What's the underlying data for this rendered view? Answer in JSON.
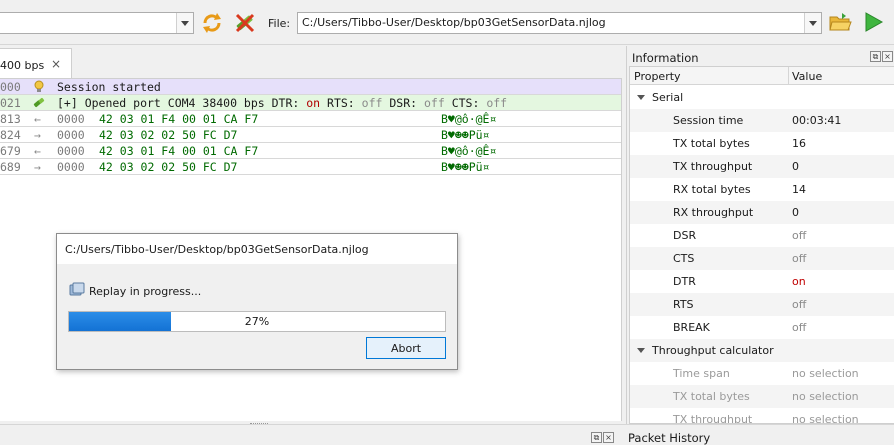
{
  "toolbar": {
    "port_combo_value": "",
    "file_label": "File:",
    "file_path": "C:/Users/Tibbo-User/Desktop/bp03GetSensorData.njlog"
  },
  "tab": {
    "label": "400 bps",
    "close": "×"
  },
  "log": {
    "rows": [
      {
        "ts": "000",
        "icon": "lightbulb-icon",
        "message": "Session started"
      },
      {
        "ts": "021",
        "icon": "plug-icon",
        "message_prefix": "[+] Opened port COM4 38400 bps DTR: ",
        "dtr": "on",
        "rts_label": " RTS: ",
        "rts": "off",
        "dsr_label": " DSR: ",
        "dsr": "off",
        "cts_label": " CTS: ",
        "cts": "off"
      },
      {
        "ts": "813",
        "dir": "←",
        "offset": "0000",
        "hex": "42 03 01 F4 00 01 CA F7",
        "ascii": "B♥@ô·@Ê¤"
      },
      {
        "ts": "824",
        "dir": "→",
        "offset": "0000",
        "hex": "42 03 02 02 50 FC D7",
        "ascii": "B♥☻☻Pü¤"
      },
      {
        "ts": "679",
        "dir": "←",
        "offset": "0000",
        "hex": "42 03 01 F4 00 01 CA F7",
        "ascii": "B♥@ô·@Ê¤"
      },
      {
        "ts": "689",
        "dir": "→",
        "offset": "0000",
        "hex": "42 03 02 02 50 FC D7",
        "ascii": "B♥☻☻Pü¤"
      }
    ]
  },
  "dialog": {
    "title": "C:/Users/Tibbo-User/Desktop/bp03GetSensorData.njlog",
    "status": "Replay in progress...",
    "progress_fraction": 0.27,
    "progress_text": "27%",
    "abort_label": "Abort"
  },
  "info_panel": {
    "title": "Information",
    "columns": {
      "property": "Property",
      "value": "Value"
    },
    "groups": [
      {
        "name": "Serial",
        "items": [
          {
            "key": "Session time",
            "value": "00:03:41",
            "state": "normal"
          },
          {
            "key": "TX total bytes",
            "value": "16",
            "state": "normal"
          },
          {
            "key": "TX throughput",
            "value": "0",
            "state": "normal"
          },
          {
            "key": "RX total bytes",
            "value": "14",
            "state": "normal"
          },
          {
            "key": "RX throughput",
            "value": "0",
            "state": "normal"
          },
          {
            "key": "DSR",
            "value": "off",
            "state": "off"
          },
          {
            "key": "CTS",
            "value": "off",
            "state": "off"
          },
          {
            "key": "DTR",
            "value": "on",
            "state": "on"
          },
          {
            "key": "RTS",
            "value": "off",
            "state": "off"
          },
          {
            "key": "BREAK",
            "value": "off",
            "state": "off"
          }
        ]
      },
      {
        "name": "Throughput calculator",
        "items": [
          {
            "key": "Time span",
            "value": "no selection",
            "state": "disabled"
          },
          {
            "key": "TX total bytes",
            "value": "no selection",
            "state": "disabled"
          },
          {
            "key": "TX throughput",
            "value": "no selection",
            "state": "disabled"
          }
        ]
      }
    ]
  },
  "packet_history": {
    "title": "Packet History"
  },
  "colors": {
    "hex_green": "#006a00",
    "on_red": "#c00000",
    "progress_blue": "#1372d4",
    "session_row_bg": "#e6e0fa",
    "open_row_bg": "#e4f7e0"
  }
}
